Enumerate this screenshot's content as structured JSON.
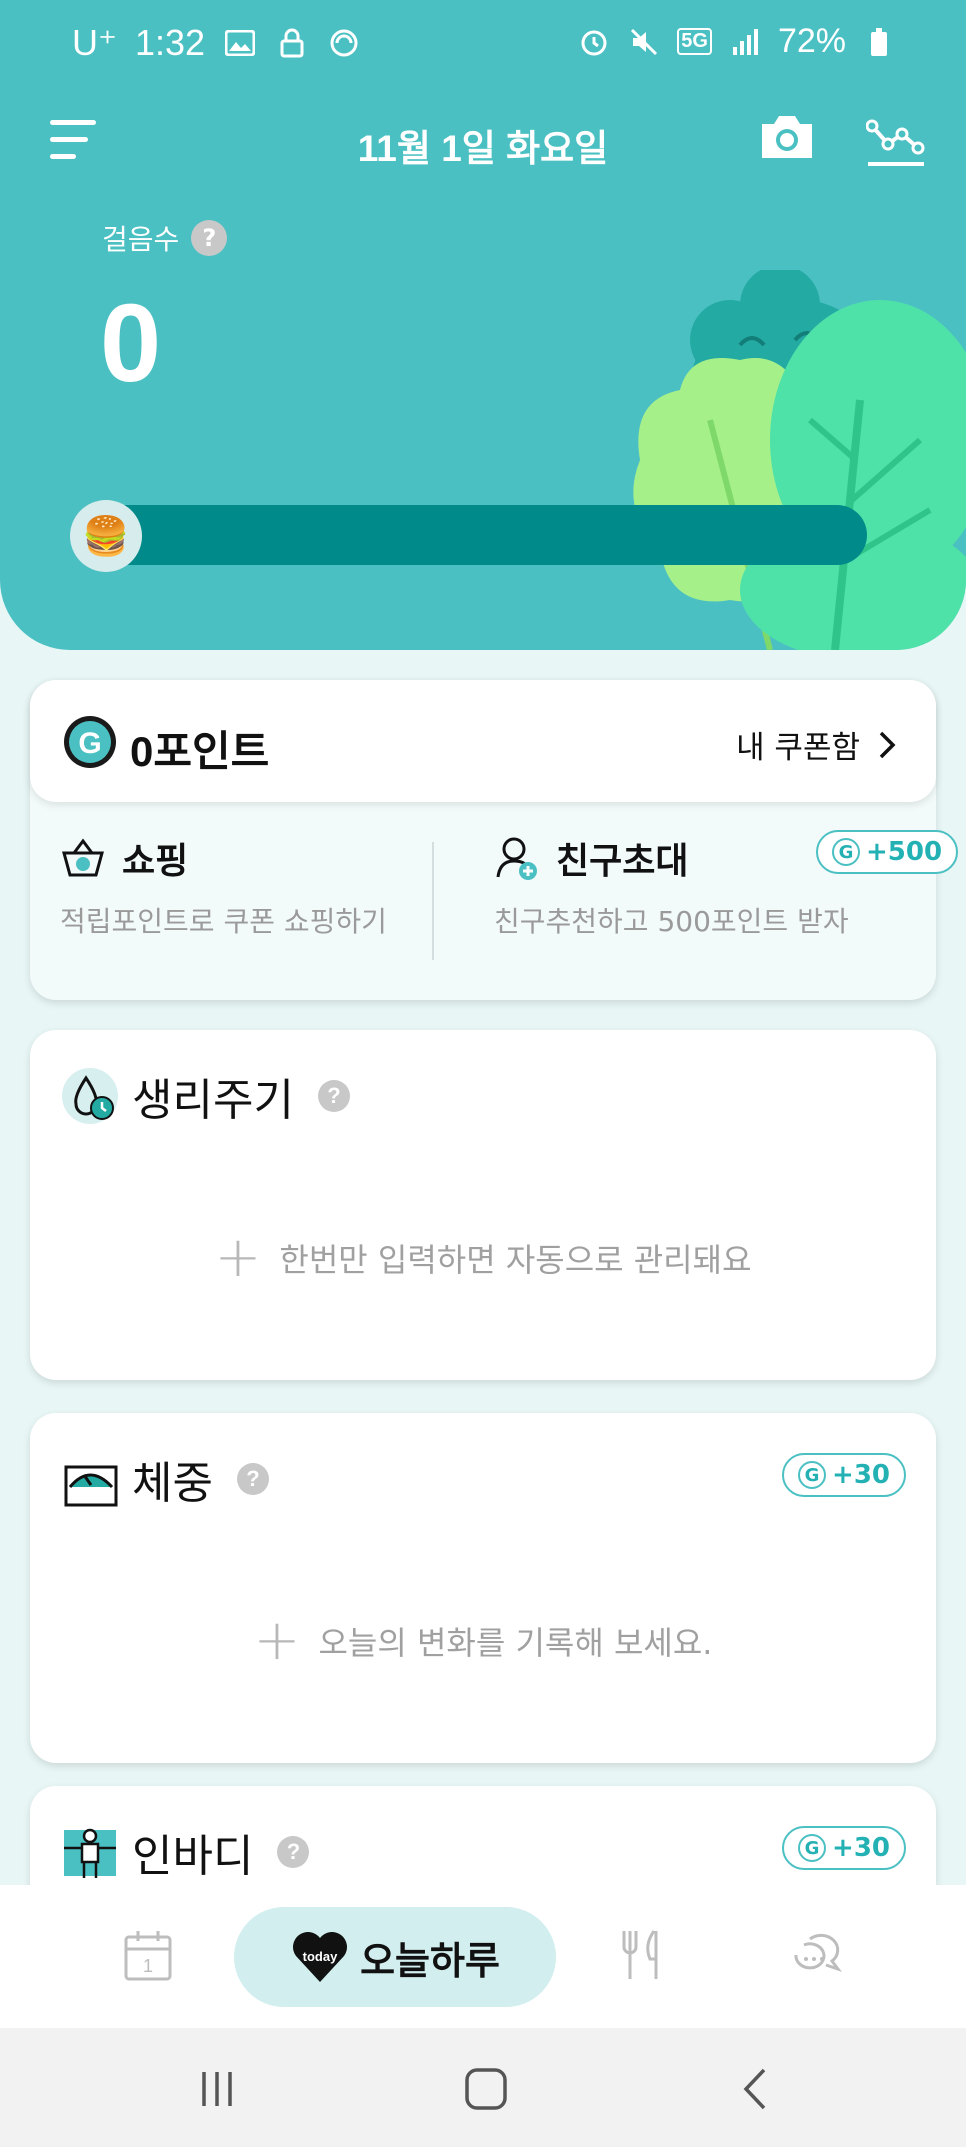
{
  "status_bar": {
    "carrier": "U⁺",
    "time": "1:32",
    "network": "5G",
    "battery": "72%"
  },
  "header": {
    "date": "11월 1일 화요일",
    "steps_label": "걸음수",
    "help_glyph": "?",
    "steps_value": "0",
    "progress_fraction": 0,
    "progress_emoji": "🍔"
  },
  "points": {
    "points_text": "0포인트",
    "coupon_label": "내 쿠폰함",
    "shopping": {
      "title": "쇼핑",
      "subtitle": "적립포인트로 쿠폰 쇼핑하기"
    },
    "invite": {
      "title": "친구초대",
      "subtitle": "친구추천하고 500포인트 받자",
      "bonus": "+500"
    },
    "g_letter": "G"
  },
  "period": {
    "title": "생리주기",
    "hint": "한번만 입력하면 자동으로 관리돼요"
  },
  "weight": {
    "title": "체중",
    "bonus": "+30",
    "hint": "오늘의 변화를 기록해 보세요."
  },
  "inbody": {
    "title": "인바디",
    "bonus": "+30"
  },
  "bottom_nav": {
    "calendar_day": "1",
    "today_badge": "today",
    "today_label": "오늘하루"
  },
  "colors": {
    "primary": "#4bc0c3",
    "progress_track": "#008a8a",
    "accent_text": "#23b1b4",
    "background": "#e8f6f6"
  },
  "icons": [
    "menu-icon",
    "camera-icon",
    "graph-icon",
    "g-point-icon",
    "chevron-right-icon",
    "shopping-basket-icon",
    "add-friend-icon",
    "period-drop-icon",
    "weight-scale-icon",
    "inbody-body-icon",
    "calendar-icon",
    "heart-today-icon",
    "fork-knife-icon",
    "chat-icon",
    "recent-apps-icon",
    "home-icon",
    "back-icon"
  ]
}
